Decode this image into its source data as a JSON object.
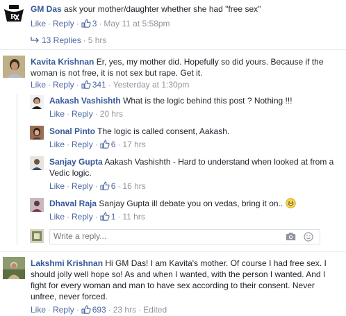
{
  "comments": [
    {
      "name": "GM Das",
      "text": "ask your mother/daughter whether she had \"free sex\"",
      "like": "Like",
      "reply": "Reply",
      "likes": "3",
      "time": "May 11 at 5:58pm"
    },
    {
      "name": "Kavita Krishnan",
      "text": "Er, yes, my mother did. Hopefully so did yours. Because if the woman is not free, it is not sex but rape. Get it.",
      "like": "Like",
      "reply": "Reply",
      "likes": "341",
      "time": "Yesterday at 1:30pm"
    },
    {
      "name": "Lakshmi Krishnan",
      "text": "Hi GM Das! I am Kavita's mother. Of course I had free sex. I should jolly well hope so! As and when I wanted, with the person I wanted. And I fight for every woman and man to have sex according to their consent. Never unfree, never forced.",
      "like": "Like",
      "reply": "Reply",
      "likes": "693",
      "time": "23 hrs",
      "edited": "Edited"
    }
  ],
  "replies_link": "13 Replies",
  "replies_time": "5 hrs",
  "replies": [
    {
      "name": "Aakash Vashishth",
      "text": "What is the logic behind this post ? Nothing !!!",
      "like": "Like",
      "reply": "Reply",
      "likes": "",
      "time": "20 hrs"
    },
    {
      "name": "Sonal Pinto",
      "text": "The logic is called consent, Aakash.",
      "like": "Like",
      "reply": "Reply",
      "likes": "6",
      "time": "17 hrs"
    },
    {
      "name": "Sanjay Gupta",
      "text": "Aakash Vashishth - Hard to understand when looked at from a Vedic logic.",
      "like": "Like",
      "reply": "Reply",
      "likes": "6",
      "time": "16 hrs"
    },
    {
      "name": "Dhaval Raja",
      "text": "Sanjay Gupta ill debate you on vedas, bring it on..",
      "emoji": "😀",
      "like": "Like",
      "reply": "Reply",
      "likes": "1",
      "time": "11 hrs"
    }
  ],
  "reply_input": {
    "placeholder": "Write a reply..."
  },
  "colors": {
    "link": "#365899",
    "meta": "#90949c",
    "divider": "#e9ebee"
  }
}
